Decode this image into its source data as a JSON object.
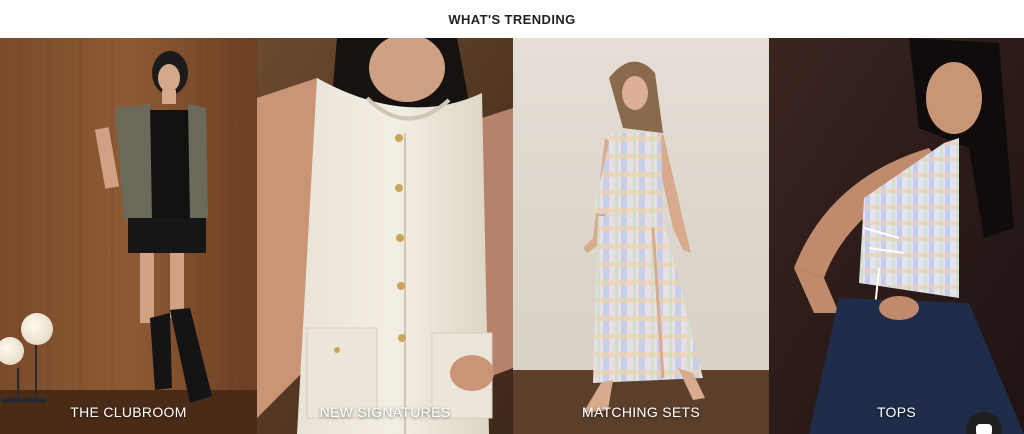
{
  "section": {
    "title": "WHAT'S TRENDING"
  },
  "tiles": [
    {
      "label": "THE CLUBROOM"
    },
    {
      "label": "NEW SIGNATURES"
    },
    {
      "label": "MATCHING SETS"
    },
    {
      "label": "TOPS"
    }
  ],
  "icons": {
    "chat": "chat-icon"
  },
  "colors": {
    "title": "#222222",
    "label": "#ffffff",
    "chat_button": "#1f1f1f"
  }
}
